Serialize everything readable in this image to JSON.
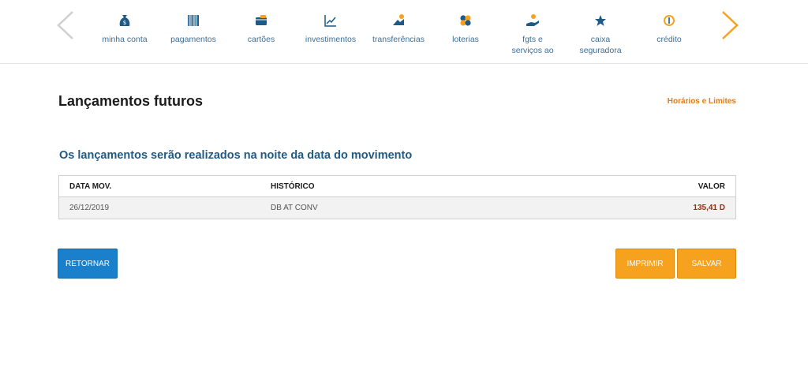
{
  "nav": {
    "items": [
      {
        "label": "minha conta",
        "icon": "money-bag-icon"
      },
      {
        "label": "pagamentos",
        "icon": "barcode-icon"
      },
      {
        "label": "cartões",
        "icon": "card-icon"
      },
      {
        "label": "investimentos",
        "icon": "chart-icon"
      },
      {
        "label": "transferências",
        "icon": "transfer-icon"
      },
      {
        "label": "loterias",
        "icon": "clover-icon"
      },
      {
        "label": "fgts e serviços ao",
        "icon": "hand-coin-icon"
      },
      {
        "label": "caixa seguradora",
        "icon": "star-icon"
      },
      {
        "label": "crédito",
        "icon": "credit-icon"
      }
    ]
  },
  "page": {
    "title": "Lançamentos futuros",
    "hours_link": "Horários e Limites",
    "subtitle": "Os lançamentos serão realizados na noite da data do movimento"
  },
  "table": {
    "headers": {
      "date": "DATA MOV.",
      "history": "HISTÓRICO",
      "value": "VALOR"
    },
    "rows": [
      {
        "date": "26/12/2019",
        "history": "DB AT CONV",
        "value": "135,41 D"
      }
    ]
  },
  "buttons": {
    "retornar": "RETORNAR",
    "imprimir": "IMPRIMIR",
    "salvar": "SALVAR"
  },
  "colors": {
    "icon_blue": "#1e5a84",
    "accent_orange": "#f6a21f",
    "primary_blue": "#1a80cc",
    "debit_value": "#9b2b12"
  }
}
